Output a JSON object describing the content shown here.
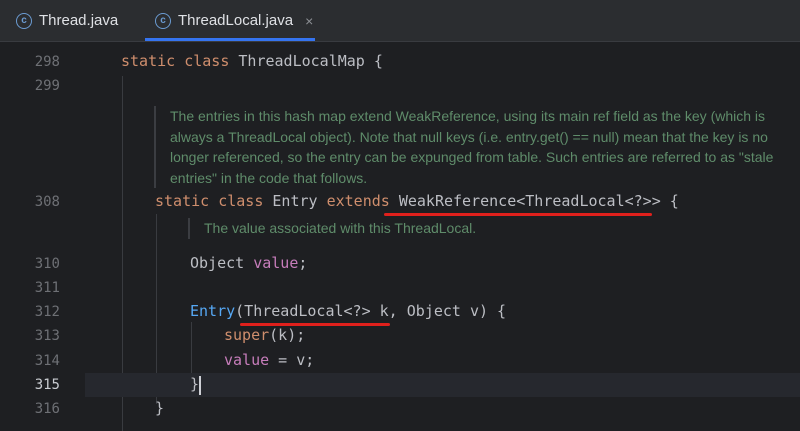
{
  "tabs": [
    {
      "label": "Thread.java",
      "active": false
    },
    {
      "label": "ThreadLocal.java",
      "active": true,
      "close": "×"
    }
  ],
  "editor": {
    "line_numbers": [
      "298",
      "299",
      "308",
      "310",
      "311",
      "312",
      "313",
      "314",
      "315",
      "316"
    ],
    "current_line": "315",
    "doc_comment_1": "The entries in this hash map extend WeakReference, using its main ref field as the key (which is always a ThreadLocal object). Note that null keys (i.e. entry.get() == null) mean that the key is no longer referenced, so the entry can be expunged from table. Such entries are referred to as \"stale entries\" in the code that follows.",
    "doc_comment_2": "The value associated with this ThreadLocal.",
    "code": {
      "l298_kw": "static class ",
      "l298_name": "ThreadLocalMap {",
      "l308_kw1": "static class ",
      "l308_name": "Entry ",
      "l308_kw2": "extends ",
      "l308_type": "WeakReference<ThreadLocal<?>> {",
      "l310_type": "Object ",
      "l310_field": "value",
      "l310_end": ";",
      "l312_fn": "Entry",
      "l312_params": "(ThreadLocal<?> k, Object v) {",
      "l313_kw": "super",
      "l313_rest": "(k);",
      "l314_field": "value",
      "l314_rest": " = v;",
      "l315_brace": "}",
      "l316_brace": "}"
    }
  },
  "colors": {
    "keyword": "#cf8e6d",
    "function": "#56a8f5",
    "field": "#c77dbb",
    "doc_comment": "#5f8c6a",
    "annotation_underline": "#e0201c",
    "active_tab_indicator": "#3574f0"
  }
}
